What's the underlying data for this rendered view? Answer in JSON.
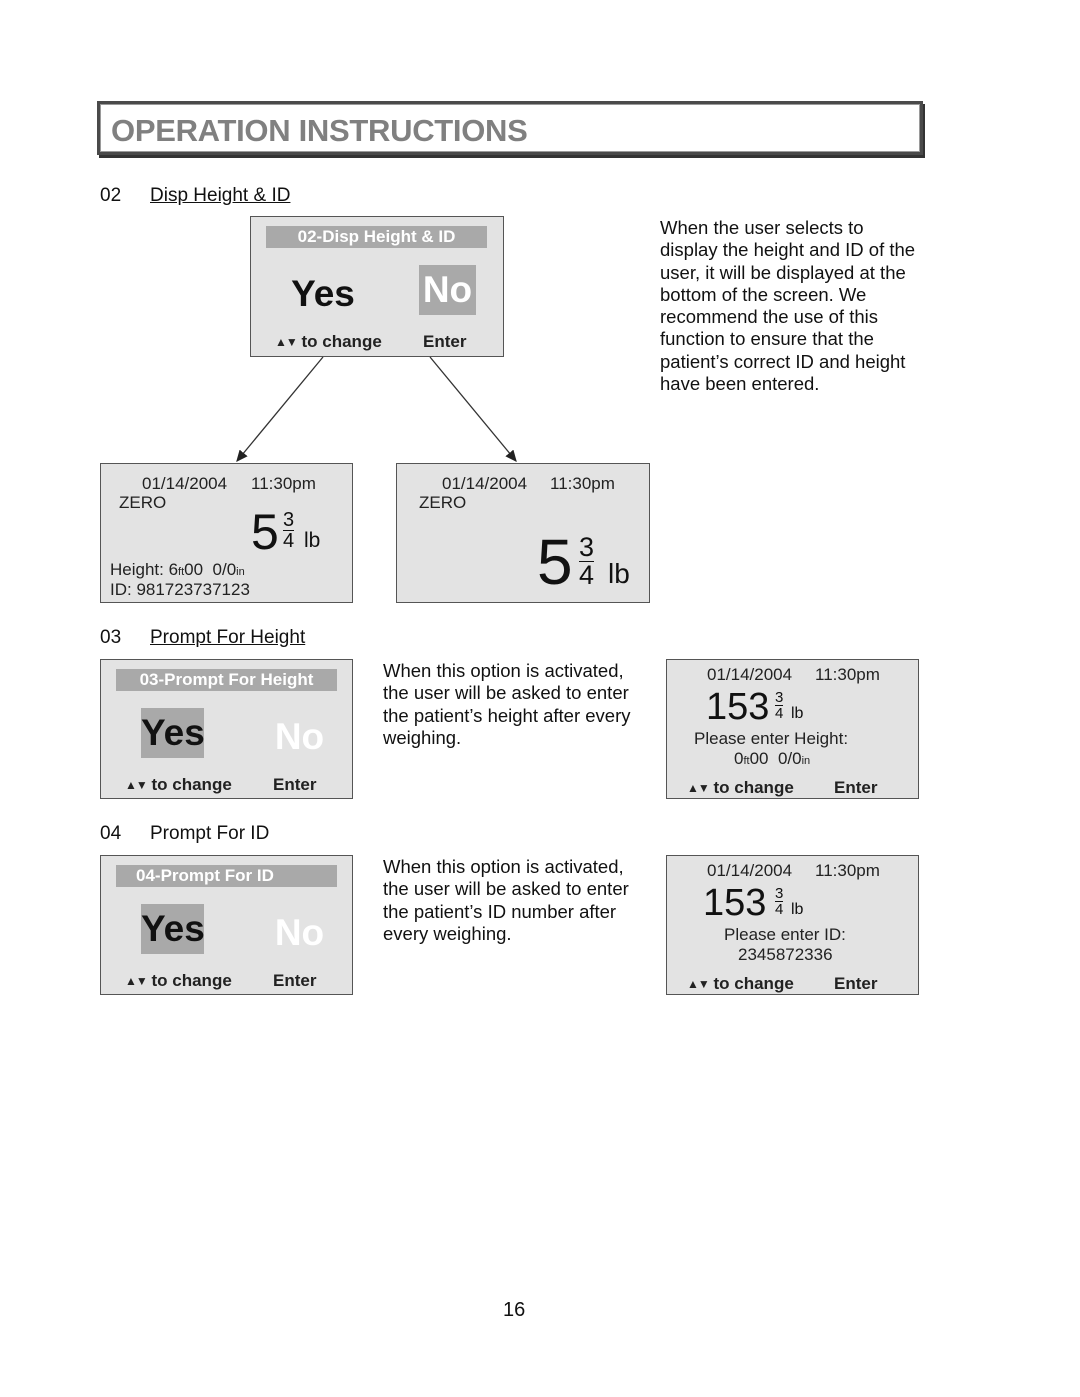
{
  "page": {
    "title": "OPERATION INSTRUCTIONS",
    "page_number": "16"
  },
  "sections": [
    {
      "number": "02",
      "title": "Disp Height & ID",
      "description": [
        "When the user selects to",
        "display the height and ID of the",
        "user, it will be displayed at the",
        "bottom of the screen. We",
        "recommend the use of this",
        "function to ensure that the",
        "patient’s correct ID and height",
        "have been entered."
      ],
      "menu_screen": {
        "title": "02-Disp Height & ID",
        "options": [
          {
            "label": "Yes",
            "selected": false
          },
          {
            "label": "No",
            "selected": true
          }
        ],
        "footer_arrows": "▲▼",
        "footer_hint": "to change",
        "footer_enter": "Enter"
      },
      "result_screens": [
        {
          "date": "01/14/2004",
          "time": "11:30pm",
          "status": "ZERO",
          "weight_whole": "5",
          "weight_num": "3",
          "weight_den": "4",
          "weight_unit": "lb",
          "height_label": "Height: 6",
          "height_ft_unit": "ft",
          "height_mid": "00  0/0",
          "height_in_unit": "in",
          "id_line": "ID: 981723737123"
        },
        {
          "date": "01/14/2004",
          "time": "11:30pm",
          "status": "ZERO",
          "weight_whole": "5",
          "weight_num": "3",
          "weight_den": "4",
          "weight_unit": "lb"
        }
      ]
    },
    {
      "number": "03",
      "title": "Prompt For Height",
      "description": [
        "When this option is activated,",
        "the user will be asked to enter",
        "the patient’s height after every",
        "weighing."
      ],
      "menu_screen": {
        "title": "03-Prompt For Height",
        "options": [
          {
            "label": "Yes",
            "selected": true
          },
          {
            "label": "No",
            "selected": false
          }
        ],
        "footer_arrows": "▲▼",
        "footer_hint": "to change",
        "footer_enter": "Enter"
      },
      "result_screen": {
        "date": "01/14/2004",
        "time": "11:30pm",
        "weight_whole": "153",
        "weight_num": "3",
        "weight_den": "4",
        "weight_unit": "lb",
        "prompt": "Please enter Height:",
        "value_a": "0",
        "value_ft_unit": "ft",
        "value_b": "00  0/0",
        "value_in_unit": "in",
        "footer_arrows": "▲▼",
        "footer_hint": "to change",
        "footer_enter": "Enter"
      }
    },
    {
      "number": "04",
      "title": "Prompt For ID",
      "description": [
        "When this option is activated,",
        "the user will be asked to enter",
        "the patient’s ID number after",
        "every weighing."
      ],
      "menu_screen": {
        "title": "04-Prompt For ID",
        "options": [
          {
            "label": "Yes",
            "selected": true
          },
          {
            "label": "No",
            "selected": false
          }
        ],
        "footer_arrows": "▲▼",
        "footer_hint": "to change",
        "footer_enter": "Enter"
      },
      "result_screen": {
        "date": "01/14/2004",
        "time": "11:30pm",
        "weight_whole": "153",
        "weight_num": "3",
        "weight_den": "4",
        "weight_unit": "lb",
        "prompt": "Please enter ID:",
        "value": "2345872336",
        "footer_arrows": "▲▼",
        "footer_hint": "to change",
        "footer_enter": "Enter"
      }
    }
  ]
}
